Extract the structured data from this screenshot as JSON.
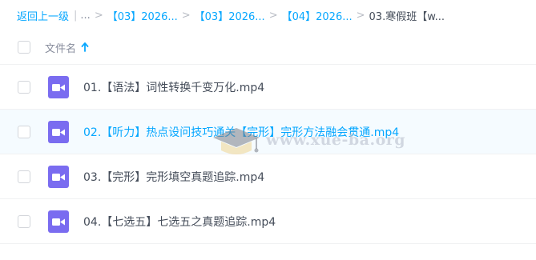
{
  "breadcrumb": {
    "back_label": "返回上一级",
    "ellipsis": "...",
    "items": [
      "【03】2026...",
      "【03】2026...",
      "【04】2026..."
    ],
    "current": "03.寒假班【w..."
  },
  "list_header": {
    "name_label": "文件名",
    "sort_icon": "arrow-up-icon"
  },
  "files": [
    {
      "name": "01.【语法】词性转换千变万化.mp4",
      "icon": "video-file-icon"
    },
    {
      "name": "02.【听力】热点设问技巧通关【完形】完形方法融会贯通.mp4",
      "icon": "video-file-icon"
    },
    {
      "name": "03.【完形】完形填空真题追踪.mp4",
      "icon": "video-file-icon"
    },
    {
      "name": "04.【七选五】七选五之真题追踪.mp4",
      "icon": "video-file-icon"
    }
  ],
  "watermark": {
    "text": "www.xue-ba.org"
  },
  "colors": {
    "accent": "#06a7ff",
    "video_icon": "#7a6cf0",
    "text": "#454d5a"
  }
}
